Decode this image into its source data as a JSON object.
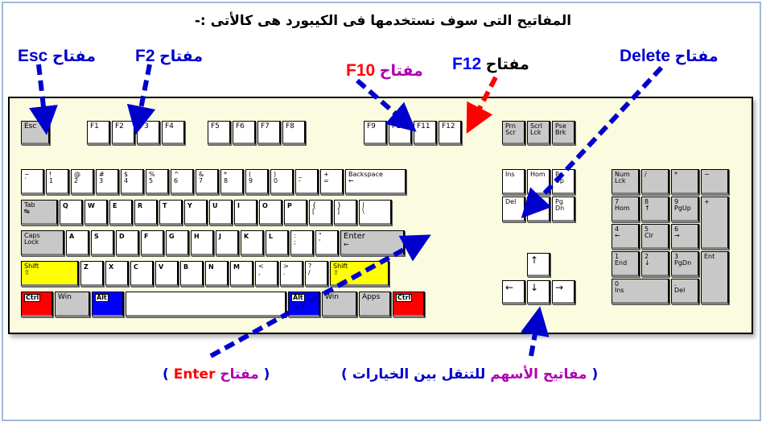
{
  "page": {
    "title": "المفاتيح التى سوف نستخدمها فى الكيبورد هى كالأتى :-",
    "frame_color": "#9fb8d8",
    "keyboard_body_color": "#fbfbe0"
  },
  "callouts": [
    {
      "id": "esc",
      "arabic": "مفتاح",
      "key": "Esc",
      "arabic_color": "#0000cc",
      "key_color": "#0000cc",
      "arrow_color": "#0000cc"
    },
    {
      "id": "f2",
      "arabic": "مفتاح",
      "key": "F2",
      "arabic_color": "#0000cc",
      "key_color": "#0000cc",
      "arrow_color": "#0000cc"
    },
    {
      "id": "f10",
      "arabic": "مفتاح",
      "key": "F10",
      "arabic_color": "#b000b0",
      "key_color": "#ff0000",
      "arrow_color": "#0000cc"
    },
    {
      "id": "f12",
      "arabic": "مفتاح",
      "key": "F12",
      "arabic_color": "#000000",
      "key_color": "#0000ff",
      "arrow_color": "#ff0000"
    },
    {
      "id": "delete",
      "arabic": "مفتاح",
      "key": "Delete",
      "arabic_color": "#0000cc",
      "key_color": "#0000cc",
      "arrow_color": "#0000cc"
    }
  ],
  "captions": {
    "enter": {
      "open": "(",
      "arabic": "مفتاح",
      "key": "Enter",
      "close": ")",
      "paren_color": "#0000cc",
      "arabic_color": "#b000b0",
      "key_color": "#ff0000"
    },
    "arrows": {
      "open": "(",
      "highlight": "مفاتيح الأسهم",
      "rest": "للتنقل بين الخيارات",
      "close": ")",
      "paren_color": "#0000cc",
      "highlight_color": "#b000b0",
      "rest_color": "#0000cc"
    }
  },
  "keyboard": {
    "function_row": {
      "escape": {
        "label": "Esc",
        "fill": "gray"
      },
      "group1": [
        {
          "label": "F1"
        },
        {
          "label": "F2"
        },
        {
          "label": "F3"
        },
        {
          "label": "F4"
        }
      ],
      "group2": [
        {
          "label": "F5"
        },
        {
          "label": "F6"
        },
        {
          "label": "F7"
        },
        {
          "label": "F8"
        }
      ],
      "group3": [
        {
          "label": "F9"
        },
        {
          "label": "F10"
        },
        {
          "label": "F11"
        },
        {
          "label": "F12"
        }
      ],
      "system": [
        {
          "l1": "Prn",
          "l2": "Scr",
          "fill": "gray"
        },
        {
          "l1": "Scrl",
          "l2": "Lck",
          "fill": "gray"
        },
        {
          "l1": "Pse",
          "l2": "Brk",
          "fill": "gray"
        }
      ]
    },
    "row_numbers": [
      {
        "l1": "~",
        "l2": "`"
      },
      {
        "l1": "!",
        "l2": "1"
      },
      {
        "l1": "@",
        "l2": "2"
      },
      {
        "l1": "#",
        "l2": "3"
      },
      {
        "l1": "$",
        "l2": "4"
      },
      {
        "l1": "%",
        "l2": "5"
      },
      {
        "l1": "^",
        "l2": "6"
      },
      {
        "l1": "&",
        "l2": "7"
      },
      {
        "l1": "*",
        "l2": "8"
      },
      {
        "l1": "(",
        "l2": "9"
      },
      {
        "l1": ")",
        "l2": "0"
      },
      {
        "l1": "_",
        "l2": "-"
      },
      {
        "l1": "+",
        "l2": "="
      }
    ],
    "backspace": {
      "l1": "Backspace",
      "l2": "←"
    },
    "tab": {
      "l1": "Tab",
      "l2": "↹",
      "fill": "gray"
    },
    "row_qwerty": [
      "Q",
      "W",
      "E",
      "R",
      "T",
      "Y",
      "U",
      "I",
      "O",
      "P"
    ],
    "row_qwerty_sym": [
      {
        "l1": "{",
        "l2": "["
      },
      {
        "l1": "}",
        "l2": "]"
      },
      {
        "l1": "|",
        "l2": "\\"
      }
    ],
    "caps_lock": {
      "l1": "Caps",
      "l2": "Lock",
      "fill": "gray"
    },
    "row_home": [
      "A",
      "S",
      "D",
      "F",
      "G",
      "H",
      "J",
      "K",
      "L"
    ],
    "row_home_sym": [
      {
        "l1": ":",
        "l2": ";"
      },
      {
        "l1": "\"",
        "l2": "'"
      }
    ],
    "enter": {
      "l1": "Enter",
      "l2": "←",
      "fill": "gray"
    },
    "shift_left": {
      "l1": "Shift",
      "l2": "⇧",
      "fill": "yellow"
    },
    "shift_right": {
      "l1": "Shift",
      "l2": "⇧",
      "fill": "yellow"
    },
    "row_bottom": [
      "Z",
      "X",
      "C",
      "V",
      "B",
      "N",
      "M"
    ],
    "row_bottom_sym": [
      {
        "l1": "<",
        "l2": ","
      },
      {
        "l1": ">",
        "l2": "."
      },
      {
        "l1": "?",
        "l2": "/"
      }
    ],
    "modifier_row": [
      {
        "label": "Ctrl",
        "fill": "red",
        "tag": true
      },
      {
        "label": "Win",
        "fill": "gray",
        "tag": false
      },
      {
        "label": "Alt",
        "fill": "blue",
        "tag": true
      },
      {
        "label": "",
        "fill": "space",
        "tag": false
      },
      {
        "label": "Alt",
        "fill": "blue",
        "tag": true
      },
      {
        "label": "Win",
        "fill": "gray",
        "tag": false
      },
      {
        "label": "Apps",
        "fill": "gray",
        "tag": false
      },
      {
        "label": "Ctrl",
        "fill": "red",
        "tag": true
      }
    ],
    "nav_cluster": [
      {
        "l1": "Ins",
        "l2": ""
      },
      {
        "l1": "Hom",
        "l2": ""
      },
      {
        "l1": "Pg",
        "l2": "Up"
      },
      {
        "l1": "Del",
        "l2": ""
      },
      {
        "l1": "End",
        "l2": ""
      },
      {
        "l1": "Pg",
        "l2": "Dn"
      }
    ],
    "arrow_keys": {
      "up": "↑",
      "left": "←",
      "down": "↓",
      "right": "→"
    },
    "numpad": [
      {
        "l1": "Num",
        "l2": "Lck"
      },
      {
        "l1": "/",
        "l2": ""
      },
      {
        "l1": "*",
        "l2": ""
      },
      {
        "l1": "−",
        "l2": ""
      },
      {
        "l1": "7",
        "l2": "Hom"
      },
      {
        "l1": "8",
        "l2": "↑"
      },
      {
        "l1": "9",
        "l2": "PgUp"
      },
      {
        "l1": "+",
        "l2": ""
      },
      {
        "l1": "4",
        "l2": "←"
      },
      {
        "l1": "5",
        "l2": "Clr"
      },
      {
        "l1": "6",
        "l2": "→"
      },
      {
        "l1": "1",
        "l2": "End"
      },
      {
        "l1": "2",
        "l2": "↓"
      },
      {
        "l1": "3",
        "l2": "PgDn"
      },
      {
        "l1": "Ent",
        "l2": ""
      },
      {
        "l1": "0",
        "l2": "Ins"
      },
      {
        "l1": ".",
        "l2": "Del"
      }
    ]
  }
}
